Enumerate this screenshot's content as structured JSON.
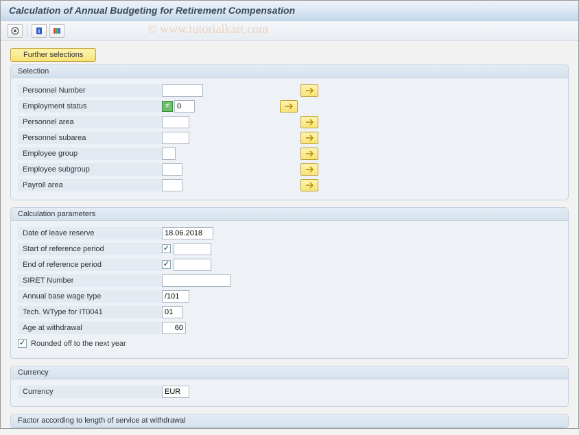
{
  "title": "Calculation of Annual Budgeting for Retirement Compensation",
  "watermark": "© www.tutorialkart.com",
  "further_selections": "Further selections",
  "groups": {
    "selection": {
      "title": "Selection",
      "fields": {
        "personnel_number": {
          "label": "Personnel Number",
          "value": ""
        },
        "employment_status": {
          "label": "Employment status",
          "value": "0"
        },
        "personnel_area": {
          "label": "Personnel area",
          "value": ""
        },
        "personnel_subarea": {
          "label": "Personnel subarea",
          "value": ""
        },
        "employee_group": {
          "label": "Employee group",
          "value": ""
        },
        "employee_subgroup": {
          "label": "Employee subgroup",
          "value": ""
        },
        "payroll_area": {
          "label": "Payroll area",
          "value": ""
        }
      }
    },
    "calc_params": {
      "title": "Calculation parameters",
      "fields": {
        "date_leave_reserve": {
          "label": "Date of leave reserve",
          "value": "18.06.2018"
        },
        "start_ref_period": {
          "label": "Start of reference period",
          "checked": true
        },
        "end_ref_period": {
          "label": "End of reference period",
          "checked": true
        },
        "siret_number": {
          "label": "SIRET Number",
          "value": ""
        },
        "annual_base_wage": {
          "label": "Annual base wage type",
          "value": "/101"
        },
        "tech_wtype": {
          "label": "Tech. WType for IT0041",
          "value": "01"
        },
        "age_withdrawal": {
          "label": "Age at withdrawal",
          "value": "60"
        },
        "rounded_off": {
          "label": "Rounded off to the next year",
          "checked": true
        }
      }
    },
    "currency": {
      "title": "Currency",
      "fields": {
        "currency": {
          "label": "Currency",
          "value": "EUR"
        }
      }
    },
    "factor": {
      "title": "Factor according to length of service at withdrawal"
    }
  }
}
